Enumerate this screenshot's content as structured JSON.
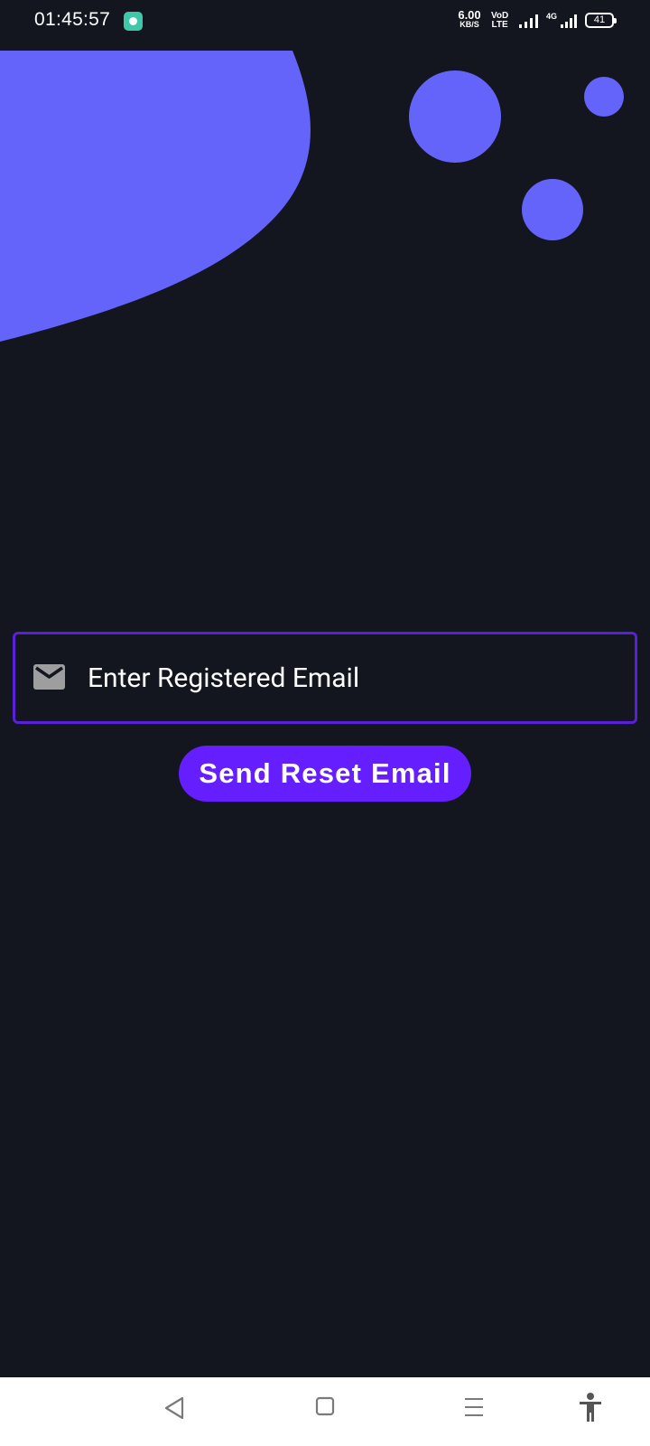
{
  "status_bar": {
    "time": "01:45:57",
    "network_speed_value": "6.00",
    "network_speed_unit": "KB/S",
    "volte_top": "VoD",
    "volte_bottom": "LTE",
    "network_type": "4G",
    "battery_level": "41",
    "app_icon": "chat-bubble-icon"
  },
  "form": {
    "email_icon": "mail-icon",
    "email_placeholder": "Enter Registered Email",
    "email_value": "",
    "send_button_label": "Send Reset Email"
  },
  "nav_bar": {
    "icons": [
      "back-triangle-icon",
      "home-square-icon",
      "recents-menu-icon",
      "accessibility-icon"
    ]
  },
  "colors": {
    "background": "#13161e",
    "decor_shape": "#6464fa",
    "field_border": "#5a1fd8",
    "button": "#651fff",
    "nav_bar": "#ffffff",
    "nav_icon": "#7a7a7a"
  }
}
